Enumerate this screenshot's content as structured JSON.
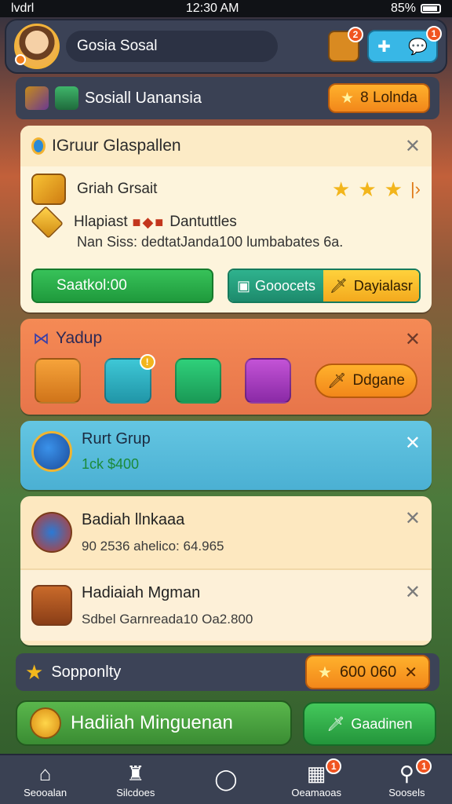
{
  "status_bar": {
    "carrier": "lvdrl",
    "time": "12:30 AM",
    "battery": "85%"
  },
  "header": {
    "user_name": "Gosia Sosal",
    "chest_badge": "2",
    "chat_badge": "1"
  },
  "social_bar": {
    "title": "Sosiall Uanansia",
    "button_label": "8 Lolnda"
  },
  "panel_group": {
    "title": "IGruur Glaspallen",
    "row1_title": "Griah Grsait",
    "row2_title": "Hlapiast",
    "row2_suffix": "Dantuttles",
    "row2_sub": "Nan Siss: dedtatJanda100 lumbabates 6a.",
    "green_button": "Saatkol:00",
    "split_left": "Gooocets",
    "split_right": "Dayialasr"
  },
  "panel_yardup": {
    "title": "Yadup",
    "tile_badge": "!",
    "button_label": "Ddgane"
  },
  "panel_rurt": {
    "title": "Rurt Grup",
    "value": "1ck $400"
  },
  "panel_badiah": {
    "title1": "Badiah llnkaaa",
    "sub1": "90 2536 ahelico: 64.965",
    "title2": "Hadiaiah Mgman",
    "sub2": "Sdbel Garnreada10 Oa2.800"
  },
  "sppty": {
    "label": "Sopponlty",
    "button_label": "600 060"
  },
  "weekly": {
    "label": "Hadiiah Minguenan",
    "button_label": "Gaadinen"
  },
  "tabbar": {
    "tabs": [
      {
        "label": "Seooalan",
        "icon": "home-icon"
      },
      {
        "label": "Silcdoes",
        "icon": "trophy-icon"
      },
      {
        "label": "",
        "icon": "refresh-icon"
      },
      {
        "label": "Oeamaoas",
        "icon": "calendar-icon",
        "badge": "1"
      },
      {
        "label": "Soosels",
        "icon": "social-icon",
        "badge": "1"
      }
    ]
  },
  "colors": {
    "accent_orange": "#f2871a",
    "green": "#1f9a3c",
    "panel_cream": "#fdf4dc"
  }
}
